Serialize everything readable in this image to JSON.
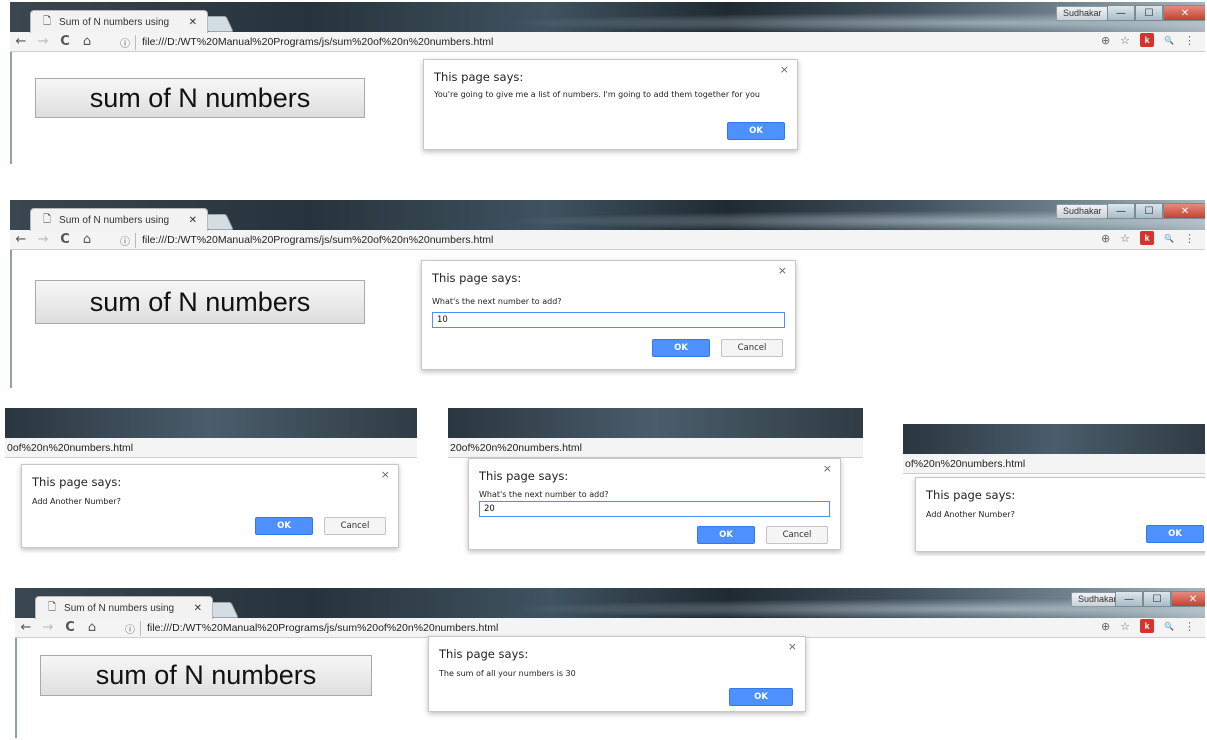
{
  "browser": {
    "tab_title": "Sum of N numbers using",
    "tab_close": "✕",
    "user": "Sudhakar",
    "url": "file:///D:/WT%20Manual%20Programs/js/sum%20of%20n%20numbers.html",
    "url_fragment_1": "0of%20n%20numbers.html",
    "url_fragment_2": "20of%20n%20numbers.html",
    "url_fragment_3": "of%20n%20numbers.html",
    "back_icon": "←",
    "forward_icon": "→",
    "reload_icon": "C",
    "home_icon": "⌂",
    "info_icon": "ⓘ",
    "zoom_icon": "⊕",
    "star_icon": "☆",
    "ext_badge": "k",
    "search_icon": "🔍",
    "menu_icon": "⋮",
    "min_icon": "—",
    "max_icon": "☐",
    "close_icon": "✕"
  },
  "page": {
    "button_label": "sum of N numbers"
  },
  "dialogs": {
    "title": "This page says:",
    "close": "×",
    "ok": "OK",
    "cancel": "Cancel",
    "intro_message": "You're going to give me a list of numbers. I'm going to add them together for you",
    "prompt_message": "What's the next number to add?",
    "first_value": "10",
    "second_value": "20",
    "another_message": "Add Another Number?",
    "result_message": "The sum of all your numbers is 30"
  }
}
